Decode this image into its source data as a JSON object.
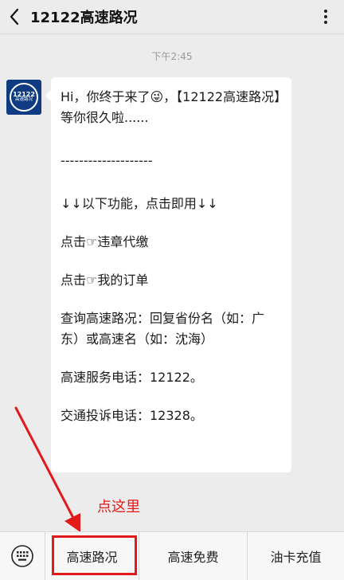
{
  "header": {
    "title": "12122高速路况",
    "back_icon": "chevron-left-icon",
    "menu_icon": "more-vertical-icon"
  },
  "chat": {
    "time": "下午2:45",
    "avatar": {
      "line1": "12122",
      "line2": "高速路况"
    },
    "message": {
      "greeting_pre": "Hi，你终于来了",
      "emoji": "😜",
      "greeting_post": "，【12122高速路况】等你很久啦......",
      "divider": "--------------------",
      "features": "↓↓以下功能，点击即用↓↓",
      "link1_prefix": "点击☞",
      "link1": "违章代缴",
      "link2_prefix": "点击☞",
      "link2": "我的订单",
      "query": "查询高速路况：回复省份名（如：广东）或高速名（如：沈海）",
      "service_phone": "高速服务电话：12122。",
      "complaint_phone": "交通投诉电话：12328。"
    }
  },
  "annotation": {
    "text": "点这里",
    "color": "#e21a1a"
  },
  "bottom_menu": {
    "keyboard_icon": "keyboard-icon",
    "items": [
      {
        "label": "高速路况"
      },
      {
        "label": "高速免费"
      },
      {
        "label": "油卡充值"
      }
    ]
  },
  "colors": {
    "link": "#576b95",
    "bubble": "#ffffff",
    "background": "#ececec",
    "avatar": "#0f3b82"
  }
}
